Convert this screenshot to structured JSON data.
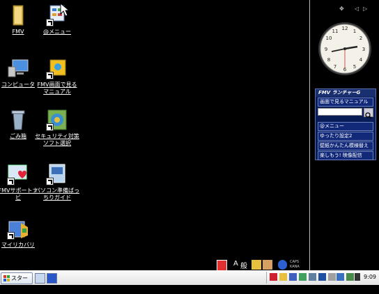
{
  "desktop": {
    "icons": [
      {
        "label": "FMV"
      },
      {
        "label": "@メニュー"
      },
      {
        "label": "コンピュータ"
      },
      {
        "label": "FMV画面で見るマニュアル"
      },
      {
        "label": "ごみ箱"
      },
      {
        "label": "セキュリティ対策ソフト選択"
      },
      {
        "label": "FMVサポートナビ"
      },
      {
        "label": "パソコン準備ばっちりガイド"
      },
      {
        "label": "マイリカバリ"
      }
    ]
  },
  "sidebar": {
    "controls": {
      "add": "✥",
      "prev": "◁",
      "next": "▷"
    },
    "launcher": {
      "title": "FMV ランチャーG",
      "manual_button": "画面で見るマニュアル",
      "search_placeholder": "",
      "items": [
        "@メニュー",
        "ゆったり設定2",
        "壁紙かんたん模様替え",
        "楽しもう! 映像配信"
      ]
    }
  },
  "langbar": {
    "ime_mode": "A",
    "ime_dict": "般",
    "caps": "CAPS",
    "kana": "KANA"
  },
  "taskbar": {
    "start_label": "スタート",
    "clock": "9:09"
  },
  "colors": {
    "desktop": "#000000",
    "launcher_bg": "#0a1c55",
    "taskbar": "#ececec"
  }
}
